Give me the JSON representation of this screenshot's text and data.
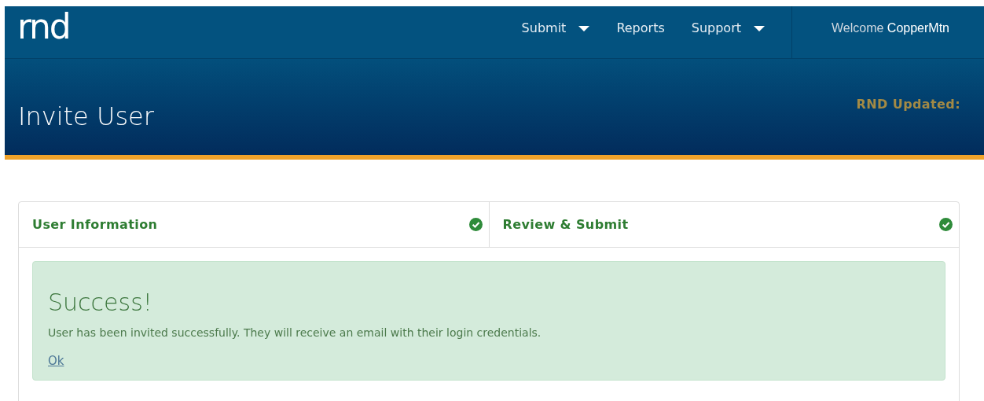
{
  "logo": "rnd",
  "nav": [
    {
      "label": "Submit",
      "has_menu": true
    },
    {
      "label": "Reports",
      "has_menu": false
    },
    {
      "label": "Support",
      "has_menu": true
    }
  ],
  "welcome": {
    "prefix": "Welcome",
    "user": "CopperMtn"
  },
  "page_title": "Invite User",
  "updated_label": "RND Updated:",
  "steps": [
    {
      "label": "User Information",
      "completed": true
    },
    {
      "label": "Review & Submit",
      "completed": true
    }
  ],
  "alert": {
    "title": "Success!",
    "message": "User has been invited successfully. They will receive an email with their login credentials.",
    "link": "Ok"
  }
}
